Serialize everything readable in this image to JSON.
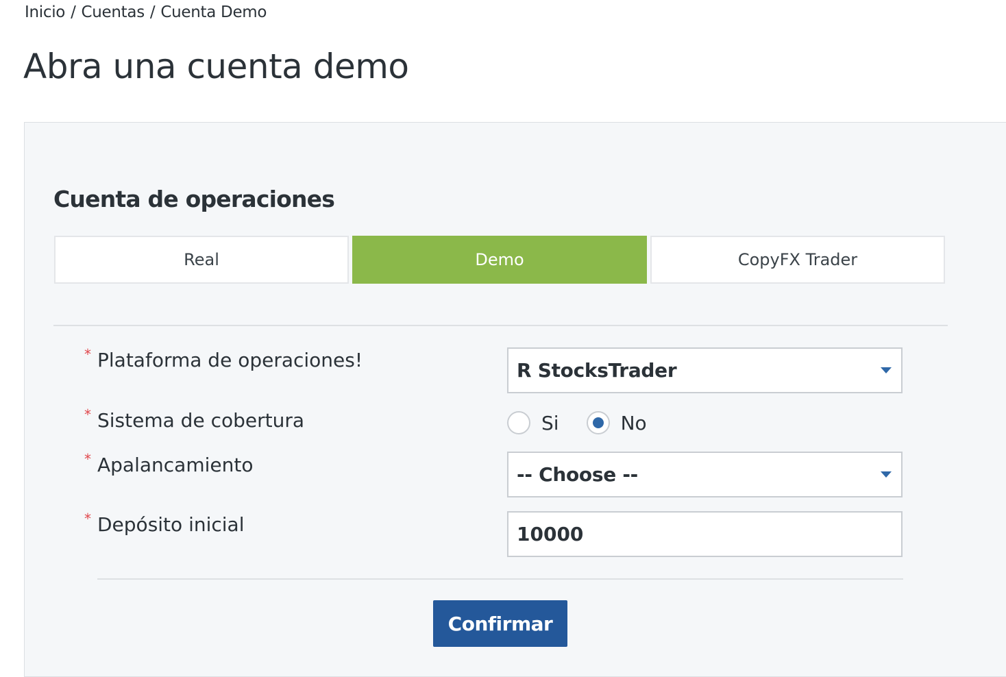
{
  "breadcrumb": {
    "items": [
      "Inicio",
      "Cuentas",
      "Cuenta Demo"
    ],
    "separator": "/"
  },
  "page_title": "Abra una cuenta demo",
  "section_title": "Cuenta de operaciones",
  "account_tabs": [
    {
      "label": "Real",
      "active": false
    },
    {
      "label": "Demo",
      "active": true
    },
    {
      "label": "CopyFX Trader",
      "active": false
    }
  ],
  "form": {
    "required_marker": "*",
    "platform": {
      "label": "Plataforma de operaciones!",
      "value": "R StocksTrader"
    },
    "hedging": {
      "label": "Sistema de cobertura",
      "options": [
        "Si",
        "No"
      ],
      "selected": "No"
    },
    "leverage": {
      "label": "Apalancamiento",
      "value": "-- Choose --"
    },
    "deposit": {
      "label": "Depósito inicial",
      "value": "10000"
    },
    "submit_label": "Confirmar"
  },
  "colors": {
    "active_tab": "#8bb84a",
    "primary_button": "#24589a",
    "required_marker": "#e0474c",
    "radio_checked": "#2f68a8"
  },
  "icons": {
    "select_caret": "caret-down-icon"
  }
}
